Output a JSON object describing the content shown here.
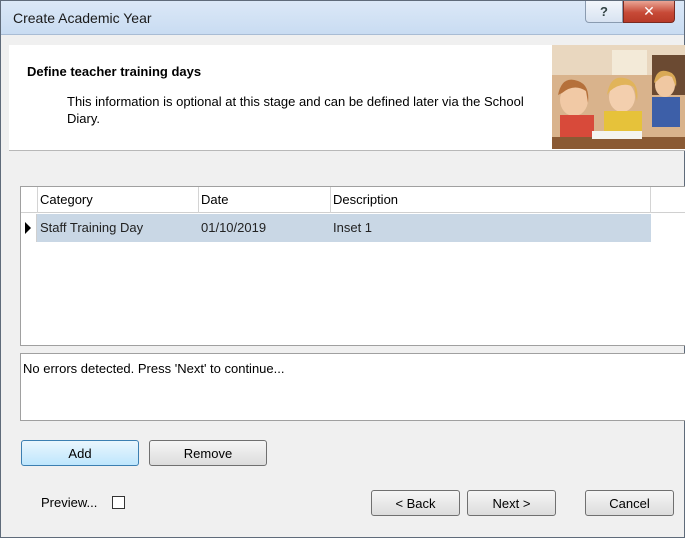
{
  "window": {
    "title": "Create Academic Year",
    "help_glyph": "?",
    "close_glyph": "✕"
  },
  "header": {
    "title": "Define teacher training days",
    "description": "This information is optional at this stage and can be defined later via the School Diary."
  },
  "grid": {
    "columns": [
      "Category",
      "Date",
      "Description"
    ],
    "rows": [
      {
        "category": "Staff Training Day",
        "date": "01/10/2019",
        "description": "Inset 1",
        "selected": true
      }
    ]
  },
  "status": {
    "message": "No errors detected. Press 'Next' to continue..."
  },
  "actions": {
    "add_label": "Add",
    "remove_label": "Remove"
  },
  "footer": {
    "preview_label": "Preview...",
    "preview_checked": false,
    "back_label": "< Back",
    "next_label": "Next >",
    "cancel_label": "Cancel"
  },
  "colors": {
    "selected_row": "#c9d7e5",
    "focused_button": "#bee6fd",
    "close_button": "#c74a37"
  },
  "icons": {
    "help": "help-icon",
    "close": "close-icon",
    "row_indicator": "row-pointer-icon"
  }
}
